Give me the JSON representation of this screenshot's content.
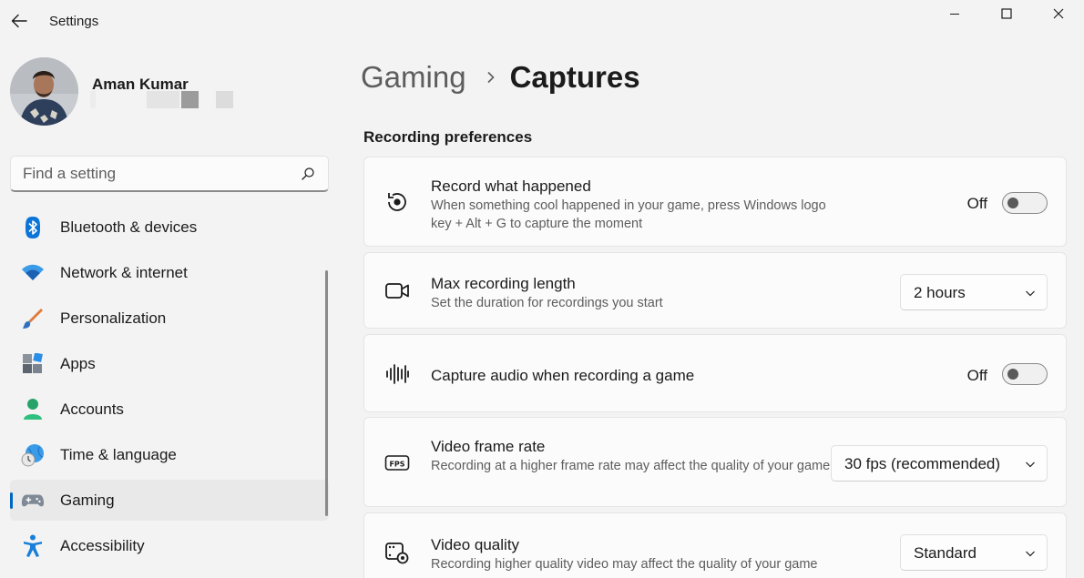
{
  "window": {
    "title": "Settings"
  },
  "profile": {
    "name": "Aman Kumar"
  },
  "search": {
    "placeholder": "Find a setting"
  },
  "sidebar": {
    "items": [
      {
        "label": "Bluetooth & devices",
        "icon": "bluetooth-icon"
      },
      {
        "label": "Network & internet",
        "icon": "wifi-icon"
      },
      {
        "label": "Personalization",
        "icon": "brush-icon"
      },
      {
        "label": "Apps",
        "icon": "apps-icon"
      },
      {
        "label": "Accounts",
        "icon": "accounts-icon"
      },
      {
        "label": "Time & language",
        "icon": "globe-clock-icon"
      },
      {
        "label": "Gaming",
        "icon": "gamepad-icon",
        "active": true
      },
      {
        "label": "Accessibility",
        "icon": "accessibility-icon"
      }
    ]
  },
  "breadcrumb": {
    "parent": "Gaming",
    "current": "Captures"
  },
  "section": {
    "title": "Recording preferences"
  },
  "cards": {
    "record_happened": {
      "title": "Record what happened",
      "desc": "When something cool happened in your game, press Windows logo key + Alt + G to capture the moment",
      "toggle_label": "Off"
    },
    "max_length": {
      "title": "Max recording length",
      "desc": "Set the duration for recordings you start",
      "value": "2 hours"
    },
    "capture_audio": {
      "title": "Capture audio when recording a game",
      "toggle_label": "Off"
    },
    "frame_rate": {
      "title": "Video frame rate",
      "desc": "Recording at a higher frame rate may affect the quality of your game",
      "value": "30 fps (recommended)"
    },
    "video_quality": {
      "title": "Video quality",
      "desc": "Recording higher quality video may affect the quality of your game",
      "value": "Standard"
    }
  },
  "colors": {
    "accent": "#0067c0",
    "background": "#f3f3f3",
    "card": "#fbfbfb"
  }
}
